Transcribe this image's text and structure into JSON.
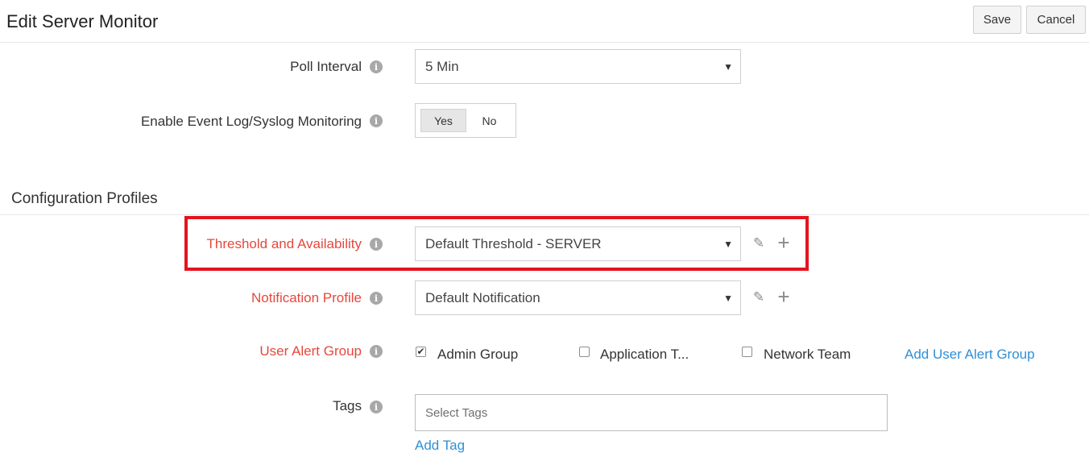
{
  "header": {
    "title": "Edit Server Monitor",
    "save_label": "Save",
    "cancel_label": "Cancel"
  },
  "poll_interval": {
    "label": "Poll Interval",
    "value": "5 Min"
  },
  "event_log": {
    "label": "Enable Event Log/Syslog Monitoring",
    "options": [
      "Yes",
      "No"
    ],
    "selected": "Yes"
  },
  "configuration_profiles": {
    "title": "Configuration Profiles",
    "threshold": {
      "label": "Threshold and Availability",
      "value": "Default Threshold - SERVER"
    },
    "notification": {
      "label": "Notification Profile",
      "value": "Default Notification"
    },
    "user_alert_group": {
      "label": "User Alert Group",
      "groups": [
        {
          "name": "Admin Group",
          "checked": true
        },
        {
          "name": "Application T...",
          "checked": false
        },
        {
          "name": "Network Team",
          "checked": false
        }
      ],
      "add_link": "Add User Alert Group"
    },
    "tags": {
      "label": "Tags",
      "placeholder": "Select Tags",
      "add_link": "Add Tag"
    }
  },
  "icons": {
    "info": "info-icon",
    "dropdown": "chevron-down-icon",
    "edit": "pencil-icon",
    "add": "plus-icon",
    "check": "checkmark-icon"
  },
  "colors": {
    "required_label": "#e5483c",
    "highlight_border": "#e3141f",
    "link": "#2f8fd6"
  }
}
